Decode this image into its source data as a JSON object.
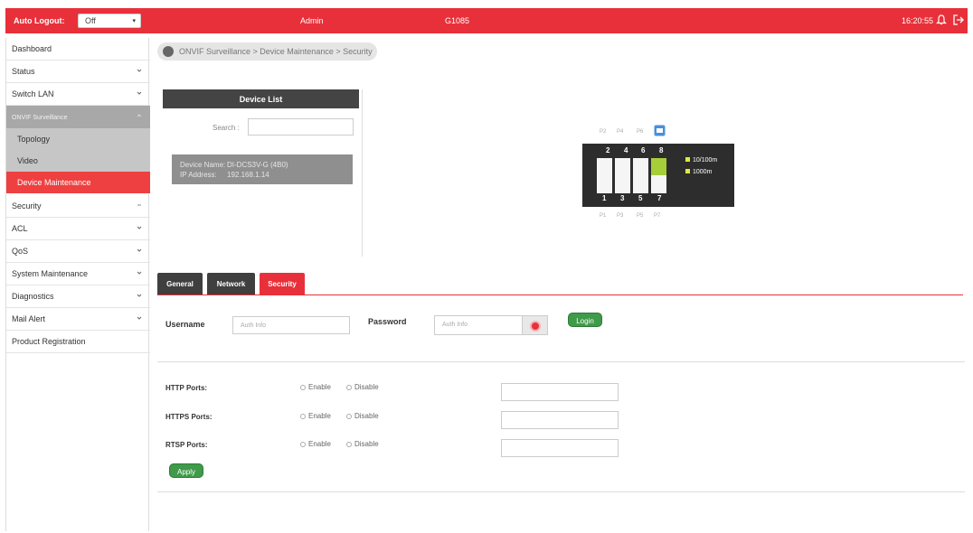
{
  "topbar": {
    "auto_logout_label": "Auto Logout:",
    "auto_logout_value": "Off",
    "user": "Admin",
    "model": "G1085",
    "time": "16:20:55"
  },
  "sidebar": {
    "items": [
      {
        "label": "Dashboard"
      },
      {
        "label": "Status"
      },
      {
        "label": "Switch LAN"
      },
      {
        "label": "ONVIF Surveillance"
      },
      {
        "label": "Topology"
      },
      {
        "label": "Video"
      },
      {
        "label": "Device Maintenance"
      },
      {
        "label": "Security"
      },
      {
        "label": "ACL"
      },
      {
        "label": "QoS"
      },
      {
        "label": "System Maintenance"
      },
      {
        "label": "Diagnostics"
      },
      {
        "label": "Mail Alert"
      },
      {
        "label": "Product Registration"
      }
    ]
  },
  "breadcrumb": "ONVIF Surveillance > Device Maintenance > Security",
  "device_list": {
    "title": "Device List",
    "search_label": "Search :",
    "device_name_label": "Device Name:",
    "device_name": "DI-DCS3V-G (4B0)",
    "ip_label": "IP Address:",
    "ip": "192.168.1.14"
  },
  "switch": {
    "top_ports": [
      "2",
      "4",
      "6",
      "8"
    ],
    "bottom_ports": [
      "1",
      "3",
      "5",
      "7"
    ],
    "top_marks": [
      "P2",
      "P4",
      "P6",
      "P8"
    ],
    "bottom_marks": [
      "P1",
      "P3",
      "P5",
      "P7"
    ],
    "legend": [
      "10/100m",
      "1000m"
    ]
  },
  "tabs": [
    "General",
    "Network",
    "Security"
  ],
  "auth": {
    "username_label": "Username",
    "username_placeholder": "Auth Info",
    "password_label": "Password",
    "password_placeholder": "Auth Info",
    "login_label": "Login"
  },
  "ports": {
    "rows": [
      {
        "label": "HTTP Ports:"
      },
      {
        "label": "HTTPS Ports:"
      },
      {
        "label": "RTSP Ports:"
      }
    ],
    "enable_label": "Enable",
    "disable_label": "Disable",
    "apply_label": "Apply"
  }
}
